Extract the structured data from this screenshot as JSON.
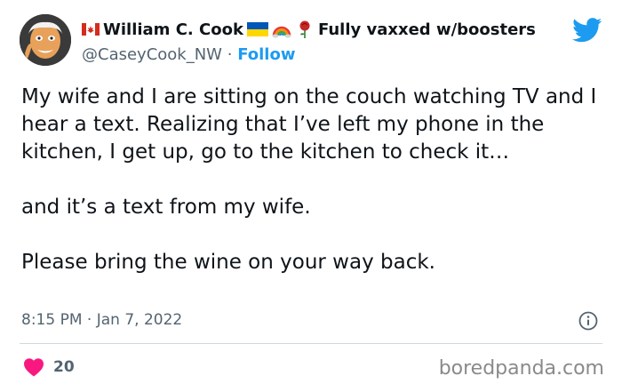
{
  "author": {
    "name": "William C. Cook",
    "name_suffix": "Fully vaxxed w/boosters",
    "handle": "@CaseyCook_NW",
    "separator": "·",
    "follow_label": "Follow",
    "emoji_icons": [
      "canada-flag-icon",
      "ukraine-flag-icon",
      "rainbow-icon",
      "rose-icon"
    ]
  },
  "tweet": {
    "paragraphs": [
      "My wife and I are sitting on the couch watching TV and I hear a text. Realizing that I’ve left my phone in the kitchen, I get up, go to the kitchen to check it…",
      "and it’s a text from my wife.",
      "Please bring the wine on your way back."
    ],
    "timestamp": "8:15 PM · Jan 7, 2022",
    "likes": "20"
  },
  "watermark": "boredpanda.com",
  "colors": {
    "text": "#0f1419",
    "muted": "#536471",
    "twitter_blue": "#1d9bf0",
    "heart": "#f91880",
    "divider": "#cfd9de"
  }
}
